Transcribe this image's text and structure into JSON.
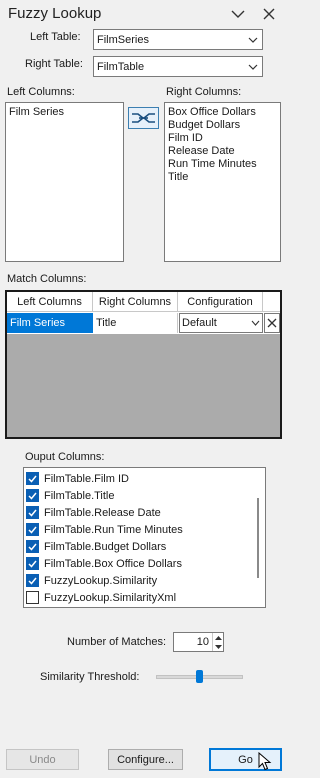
{
  "panel": {
    "title": "Fuzzy Lookup"
  },
  "tables": {
    "left_label": "Left Table:",
    "left_value": "FilmSeries",
    "right_label": "Right Table:",
    "right_value": "FilmTable"
  },
  "left_columns": {
    "label": "Left Columns:",
    "items": [
      "Film Series"
    ]
  },
  "right_columns": {
    "label": "Right Columns:",
    "items": [
      "Box Office Dollars",
      "Budget Dollars",
      "Film ID",
      "Release Date",
      "Run Time Minutes",
      "Title"
    ]
  },
  "match_columns": {
    "label": "Match Columns:",
    "headers": [
      "Left Columns",
      "Right Columns",
      "Configuration"
    ],
    "row": {
      "left": "Film Series",
      "right": "Title",
      "config": "Default"
    }
  },
  "output_columns": {
    "label": "Ouput Columns:",
    "items": [
      {
        "label": "FilmTable.Film ID",
        "checked": true
      },
      {
        "label": "FilmTable.Title",
        "checked": true
      },
      {
        "label": "FilmTable.Release Date",
        "checked": true
      },
      {
        "label": "FilmTable.Run Time Minutes",
        "checked": true
      },
      {
        "label": "FilmTable.Budget Dollars",
        "checked": true
      },
      {
        "label": "FilmTable.Box Office Dollars",
        "checked": true
      },
      {
        "label": "FuzzyLookup.Similarity",
        "checked": true
      },
      {
        "label": "FuzzyLookup.SimilarityXml",
        "checked": false
      }
    ]
  },
  "matches": {
    "label": "Number of Matches:",
    "value": "10"
  },
  "threshold": {
    "label": "Similarity Threshold:",
    "level_fraction": 0.5
  },
  "buttons": {
    "undo": "Undo",
    "configure": "Configure...",
    "go": "Go"
  },
  "colors": {
    "accent": "#0078d7",
    "checkbox": "#0a5fb4",
    "grid_empty": "#ababab"
  }
}
